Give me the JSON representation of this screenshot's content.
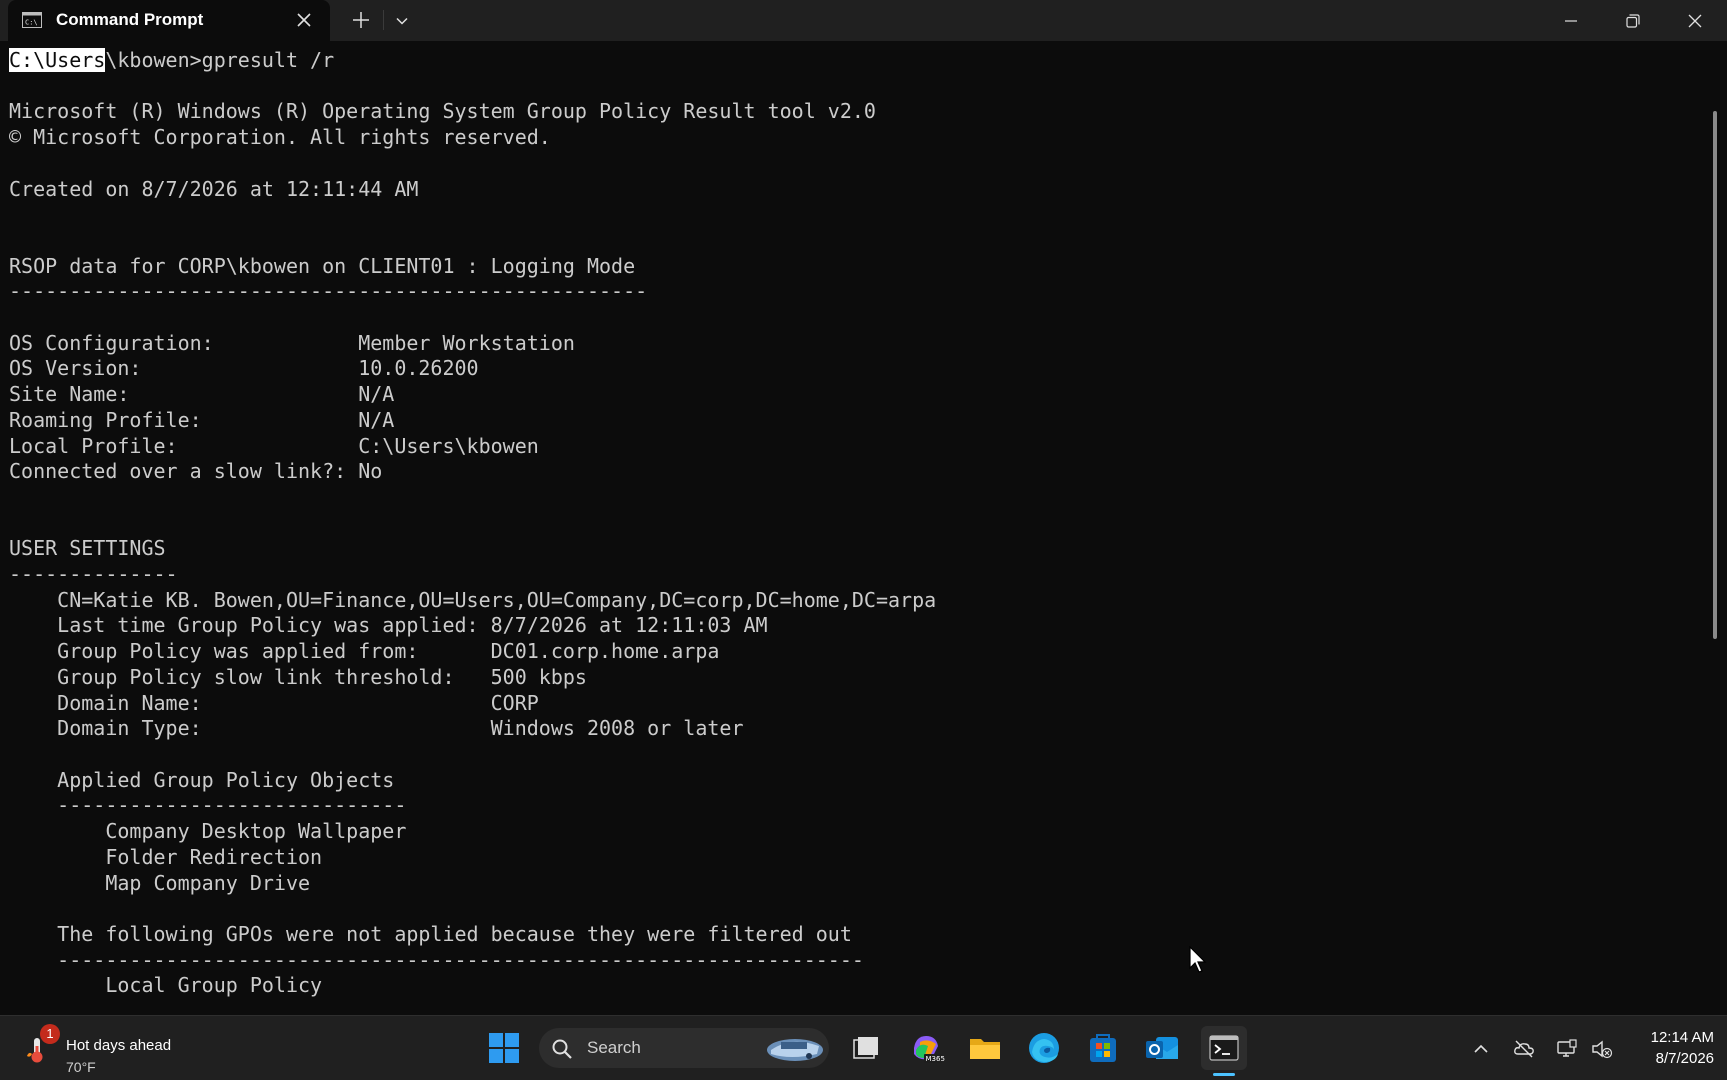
{
  "window": {
    "tab_title": "Command Prompt"
  },
  "console": {
    "prompt_highlight": "C:\\Users",
    "prompt_rest": "\\kbowen>gpresult /r",
    "lines": [
      "",
      "Microsoft (R) Windows (R) Operating System Group Policy Result tool v2.0",
      "© Microsoft Corporation. All rights reserved.",
      "",
      "Created on 8/7/2026 at 12:11:44 AM",
      "",
      "",
      "RSOP data for CORP\\kbowen on CLIENT01 : Logging Mode",
      "-----------------------------------------------------",
      "",
      "OS Configuration:            Member Workstation",
      "OS Version:                  10.0.26200",
      "Site Name:                   N/A",
      "Roaming Profile:             N/A",
      "Local Profile:               C:\\Users\\kbowen",
      "Connected over a slow link?: No",
      "",
      "",
      "USER SETTINGS",
      "--------------",
      "    CN=Katie KB. Bowen,OU=Finance,OU=Users,OU=Company,DC=corp,DC=home,DC=arpa",
      "    Last time Group Policy was applied: 8/7/2026 at 12:11:03 AM",
      "    Group Policy was applied from:      DC01.corp.home.arpa",
      "    Group Policy slow link threshold:   500 kbps",
      "    Domain Name:                        CORP",
      "    Domain Type:                        Windows 2008 or later",
      "",
      "    Applied Group Policy Objects",
      "    -----------------------------",
      "        Company Desktop Wallpaper",
      "        Folder Redirection",
      "        Map Company Drive",
      "",
      "    The following GPOs were not applied because they were filtered out",
      "    -------------------------------------------------------------------",
      "        Local Group Policy"
    ]
  },
  "taskbar": {
    "weather_title": "Hot days ahead",
    "weather_temp": "70°F",
    "weather_badge": "1",
    "search_label": "Search",
    "clock_time": "12:14 AM",
    "clock_date": "8/7/2026",
    "accent_color": "#4cc2ff"
  }
}
